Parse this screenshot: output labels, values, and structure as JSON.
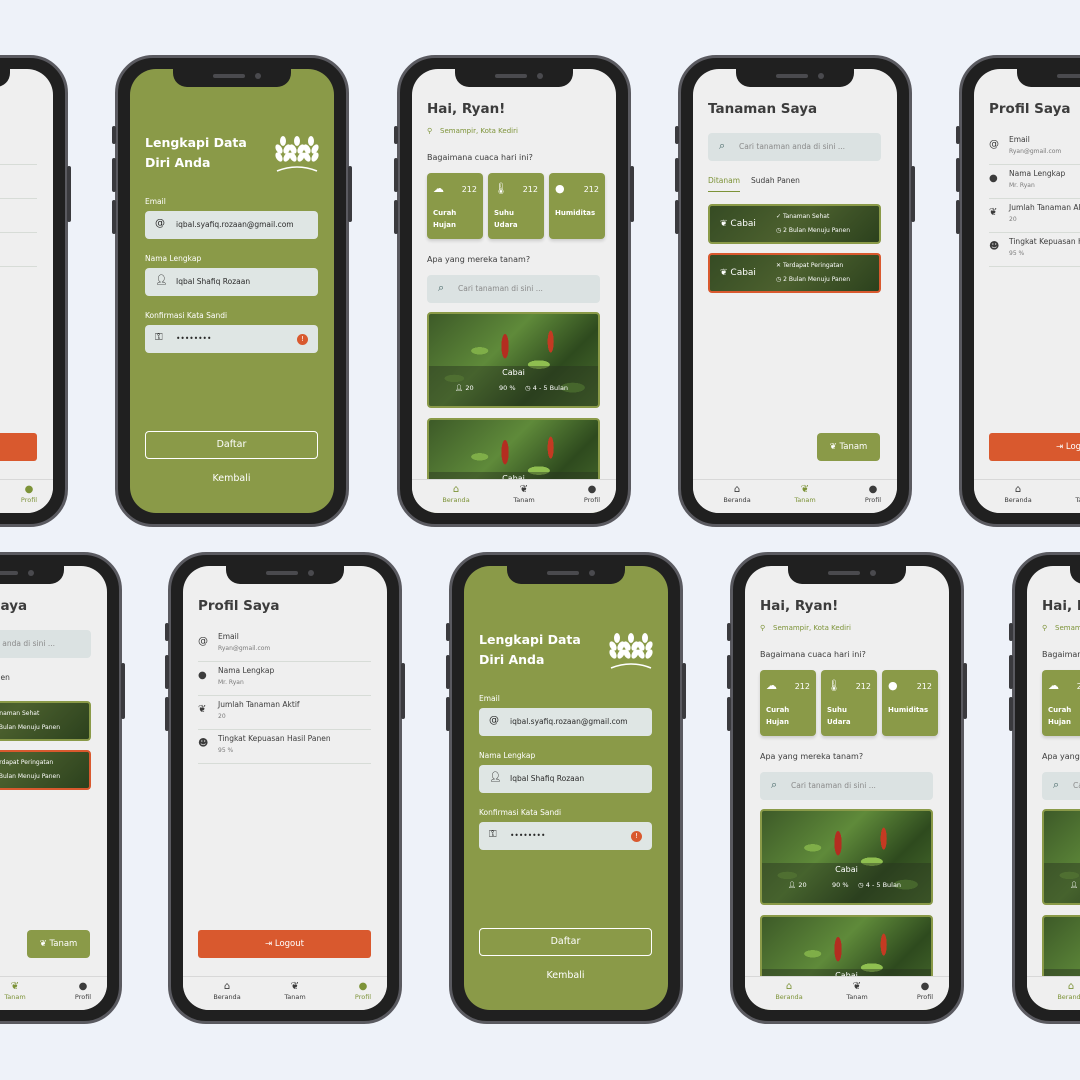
{
  "home": {
    "greeting": "Hai, Ryan!",
    "location": "Semampir, Kota Kediri",
    "weather_q": "Bagaimana cuaca hari ini?",
    "weather": [
      {
        "name": "Curah Hujan",
        "value": "212",
        "icon": "cloud-rain-icon"
      },
      {
        "name": "Suhu Udara",
        "value": "212",
        "icon": "thermometer-icon"
      },
      {
        "name": "Humiditas",
        "value": "212",
        "icon": "droplet-icon"
      }
    ],
    "plant_q": "Apa yang mereka tanam?",
    "search_placeholder": "Cari tanaman di sini ...",
    "cards": [
      {
        "name": "Cabai",
        "people": "20",
        "pct": "90 %",
        "duration": "4 - 5 Bulan"
      },
      {
        "name": "Cabai"
      }
    ]
  },
  "tanaman": {
    "title": "Tanaman Saya",
    "search_placeholder": "Cari tanaman anda di sini ...",
    "tabs": [
      "Ditanam",
      "Sudah Panen"
    ],
    "items": [
      {
        "name": "Cabai",
        "status": "Tanaman Sehat",
        "time": "2 Bulan Menuju Panen",
        "ok": true
      },
      {
        "name": "Cabai",
        "status": "Terdapat Peringatan",
        "time": "2 Bulan Menuju Panen",
        "ok": false
      }
    ],
    "button": "Tanam"
  },
  "profil": {
    "title": "Profil Saya",
    "rows": [
      {
        "label": "Email",
        "value": "Ryan@gmail.com"
      },
      {
        "label": "Nama Lengkap",
        "value": "Mr. Ryan"
      },
      {
        "label": "Jumlah Tanaman Aktif",
        "value": "20"
      },
      {
        "label": "Tingkat Kepuasan Hasil Panen",
        "value": "95 %"
      }
    ],
    "logout": "Logout"
  },
  "form": {
    "title_line1": "Lengkapi Data",
    "title_line2": "Diri Anda",
    "email_label": "Email",
    "email_value": "iqbal.syafiq.rozaan@gmail.com",
    "name_label": "Nama Lengkap",
    "name_value": "Iqbal Shafiq Rozaan",
    "pw_label": "Konfirmasi Kata Sandi",
    "pw_value": "••••••••",
    "submit": "Daftar",
    "back": "Kembali"
  },
  "nav": {
    "home": "Beranda",
    "plant": "Tanam",
    "profile": "Profil"
  },
  "colors": {
    "primary": "#8a9a48",
    "accent": "#d9592e",
    "background": "#eef2f9"
  }
}
